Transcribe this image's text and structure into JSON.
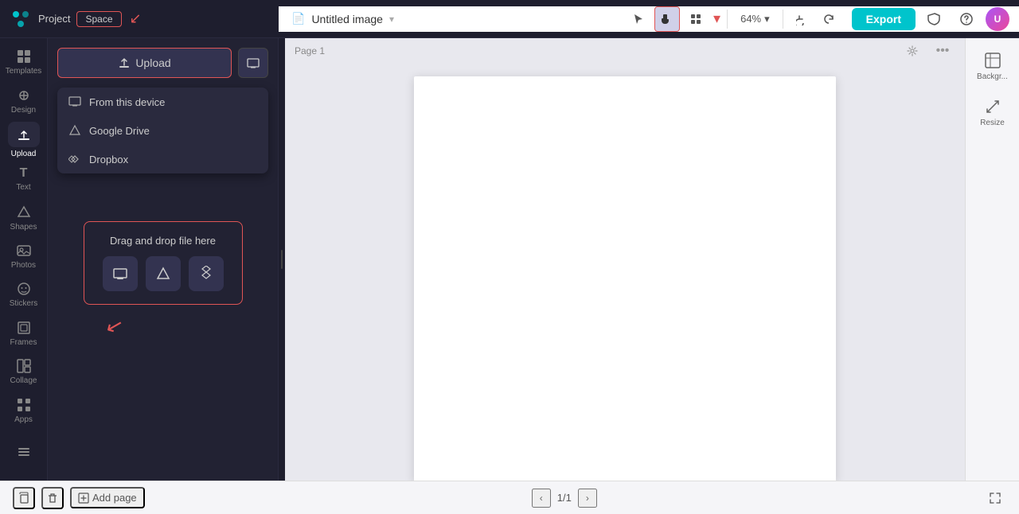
{
  "topbar": {
    "project_label": "Project",
    "space_label": "Space",
    "doc_title": "Untitled image",
    "zoom_level": "64%",
    "export_label": "Export"
  },
  "sidebar": {
    "items": [
      {
        "id": "templates",
        "label": "Templates",
        "icon": "⊞"
      },
      {
        "id": "design",
        "label": "Design",
        "icon": "🖌"
      },
      {
        "id": "upload",
        "label": "Upload",
        "icon": "⬆"
      },
      {
        "id": "text",
        "label": "Text",
        "icon": "T"
      },
      {
        "id": "shapes",
        "label": "Shapes",
        "icon": "◇"
      },
      {
        "id": "photos",
        "label": "Photos",
        "icon": "🖼"
      },
      {
        "id": "stickers",
        "label": "Stickers",
        "icon": "✦"
      },
      {
        "id": "frames",
        "label": "Frames",
        "icon": "▣"
      },
      {
        "id": "collage",
        "label": "Collage",
        "icon": "⊟"
      },
      {
        "id": "apps",
        "label": "Apps",
        "icon": "⋯"
      }
    ]
  },
  "upload_panel": {
    "upload_btn_label": "Upload",
    "dropdown_items": [
      {
        "id": "from-device",
        "label": "From this device",
        "icon": "🖥"
      },
      {
        "id": "google-drive",
        "label": "Google Drive",
        "icon": "△"
      },
      {
        "id": "dropbox",
        "label": "Dropbox",
        "icon": "⬡"
      }
    ],
    "dropzone_text": "Drag and drop file here",
    "dropzone_icons": [
      {
        "id": "device-icon",
        "icon": "🖥"
      },
      {
        "id": "gdrive-icon",
        "icon": "△"
      },
      {
        "id": "dropbox-icon",
        "icon": "⬡"
      }
    ]
  },
  "canvas": {
    "page_label": "Page 1"
  },
  "right_sidebar": {
    "items": [
      {
        "id": "background",
        "label": "Backgr...",
        "icon": "⬚"
      },
      {
        "id": "resize",
        "label": "Resize",
        "icon": "⤢"
      }
    ]
  },
  "bottombar": {
    "add_page_label": "Add page",
    "page_counter": "1/1"
  }
}
